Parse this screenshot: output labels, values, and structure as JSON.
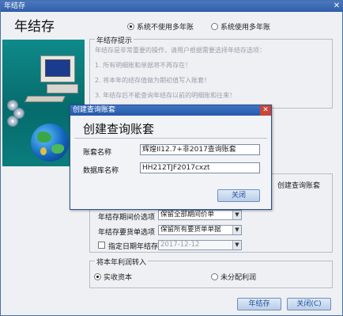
{
  "window": {
    "title": "年结存",
    "close_glyph": "✕"
  },
  "heading": "年结存",
  "mode_options": [
    {
      "label": "系统不使用多年账",
      "selected": true
    },
    {
      "label": "系统使用多年账",
      "selected": false
    }
  ],
  "tips": {
    "title": "年结存提示",
    "lines": [
      "年结存是非常重要的操作，请用户根据需要选择年结存选项：",
      "1. 所有明细账和单据将不再存在！",
      "2. 将本年的结存值做为期初值写入账套！",
      "3. 年结存后不能查询年结存以前的明细账和往来！"
    ]
  },
  "side_label": "创建查询账套",
  "settings": {
    "detail_label": "年结存期间价选项",
    "detail_value": "保留全部期间价单",
    "payable_label": "年结存要货单选项",
    "payable_value": "保留所有要货单单据",
    "date_check_label": "指定日期年结存",
    "date_value": "2017-12-12",
    "date_checked": false
  },
  "profit": {
    "title": "将本年利润转入",
    "options": [
      {
        "label": "实收资本",
        "selected": true
      },
      {
        "label": "未分配利润",
        "selected": false
      }
    ]
  },
  "buttons": {
    "carry": "年结存",
    "close": "关闭(C)"
  },
  "dialog": {
    "title": "创建查询账套",
    "close_glyph": "✕",
    "heading": "创建查询账套",
    "account_label": "账套名称",
    "account_value": "辉煌II12.7+非2017查询账套",
    "db_label": "数据库名称",
    "db_value": "HH212TJF2017cxzt",
    "close_button": "关闭"
  },
  "colors": {
    "title_bar": "#2f5ea8",
    "accent_button": "#1d4e9a",
    "art_background": "#0b7d7d"
  }
}
